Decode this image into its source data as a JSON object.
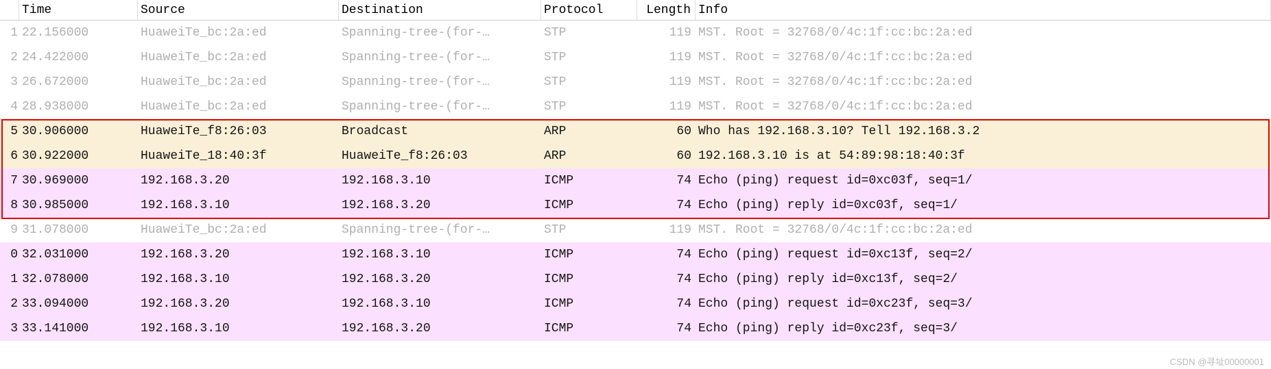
{
  "columns": {
    "no": "",
    "time": "Time",
    "source": "Source",
    "destination": "Destination",
    "protocol": "Protocol",
    "length": "Length",
    "info": "Info"
  },
  "rows": [
    {
      "no": "1",
      "time": "22.156000",
      "source": "HuaweiTe_bc:2a:ed",
      "destination": "Spanning-tree-(for-…",
      "protocol": "STP",
      "length": "119",
      "info": "MST. Root = 32768/0/4c:1f:cc:bc:2a:ed",
      "cls": "stp"
    },
    {
      "no": "2",
      "time": "24.422000",
      "source": "HuaweiTe_bc:2a:ed",
      "destination": "Spanning-tree-(for-…",
      "protocol": "STP",
      "length": "119",
      "info": "MST. Root = 32768/0/4c:1f:cc:bc:2a:ed",
      "cls": "stp"
    },
    {
      "no": "3",
      "time": "26.672000",
      "source": "HuaweiTe_bc:2a:ed",
      "destination": "Spanning-tree-(for-…",
      "protocol": "STP",
      "length": "119",
      "info": "MST. Root = 32768/0/4c:1f:cc:bc:2a:ed",
      "cls": "stp"
    },
    {
      "no": "4",
      "time": "28.938000",
      "source": "HuaweiTe_bc:2a:ed",
      "destination": "Spanning-tree-(for-…",
      "protocol": "STP",
      "length": "119",
      "info": "MST. Root = 32768/0/4c:1f:cc:bc:2a:ed",
      "cls": "stp"
    },
    {
      "no": "5",
      "time": "30.906000",
      "source": "HuaweiTe_f8:26:03",
      "destination": "Broadcast",
      "protocol": "ARP",
      "length": "60",
      "info": "Who has 192.168.3.10? Tell 192.168.3.2",
      "cls": "arp"
    },
    {
      "no": "6",
      "time": "30.922000",
      "source": "HuaweiTe_18:40:3f",
      "destination": "HuaweiTe_f8:26:03",
      "protocol": "ARP",
      "length": "60",
      "info": "192.168.3.10 is at 54:89:98:18:40:3f",
      "cls": "arp"
    },
    {
      "no": "7",
      "time": "30.969000",
      "source": "192.168.3.20",
      "destination": "192.168.3.10",
      "protocol": "ICMP",
      "length": "74",
      "info": "Echo (ping) request  id=0xc03f, seq=1/",
      "cls": "icmp"
    },
    {
      "no": "8",
      "time": "30.985000",
      "source": "192.168.3.10",
      "destination": "192.168.3.20",
      "protocol": "ICMP",
      "length": "74",
      "info": "Echo (ping) reply    id=0xc03f, seq=1/",
      "cls": "icmp"
    },
    {
      "no": "9",
      "time": "31.078000",
      "source": "HuaweiTe_bc:2a:ed",
      "destination": "Spanning-tree-(for-…",
      "protocol": "STP",
      "length": "119",
      "info": "MST. Root = 32768/0/4c:1f:cc:bc:2a:ed",
      "cls": "stp"
    },
    {
      "no": "0",
      "time": "32.031000",
      "source": "192.168.3.20",
      "destination": "192.168.3.10",
      "protocol": "ICMP",
      "length": "74",
      "info": "Echo (ping) request  id=0xc13f, seq=2/",
      "cls": "icmp"
    },
    {
      "no": "1",
      "time": "32.078000",
      "source": "192.168.3.10",
      "destination": "192.168.3.20",
      "protocol": "ICMP",
      "length": "74",
      "info": "Echo (ping) reply    id=0xc13f, seq=2/",
      "cls": "icmp"
    },
    {
      "no": "2",
      "time": "33.094000",
      "source": "192.168.3.20",
      "destination": "192.168.3.10",
      "protocol": "ICMP",
      "length": "74",
      "info": "Echo (ping) request  id=0xc23f, seq=3/",
      "cls": "icmp"
    },
    {
      "no": "3",
      "time": "33.141000",
      "source": "192.168.3.10",
      "destination": "192.168.3.20",
      "protocol": "ICMP",
      "length": "74",
      "info": "Echo (ping) reply    id=0xc23f, seq=3/",
      "cls": "icmp"
    }
  ],
  "watermark": "CSDN @寻址00000001"
}
